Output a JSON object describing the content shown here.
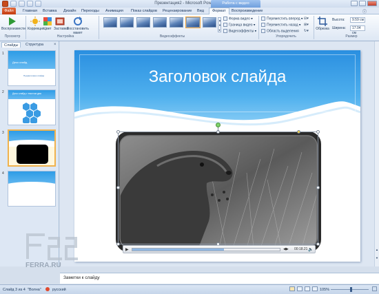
{
  "window": {
    "title": "Презентация2 - Microsoft PowerPoint",
    "context_tab_header": "Работа с видео"
  },
  "tabs": {
    "file": "Файл",
    "items": [
      "Главная",
      "Вставка",
      "Дизайн",
      "Переходы",
      "Анимация",
      "Показ слайдов",
      "Рецензирование",
      "Вид",
      "Формат",
      "Воспроизведение"
    ],
    "active": "Формат"
  },
  "ribbon": {
    "preview_group": {
      "play": "Воспроизвести",
      "label": "Просмотр"
    },
    "adjust_group": {
      "correction": "Коррекция",
      "color": "Цвет",
      "poster": "Заставка",
      "reset": "Восстановить макет",
      "label": "Настройка"
    },
    "styles_group": {
      "label": "Видеоэффекты",
      "thumb_count": 7
    },
    "shape_buttons": {
      "shape": "Форма видео",
      "border": "Граница видео",
      "effects": "Видеоэффекты"
    },
    "arrange_group": {
      "forward": "Переместить вперед",
      "backward": "Переместить назад",
      "selection": "Область выделения",
      "label": "Упорядочить"
    },
    "size_group": {
      "crop": "Обрезка",
      "height_label": "Высота:",
      "height_value": "9.59 см",
      "width_label": "Ширина:",
      "width_value": "17.04 см",
      "label": "Размер"
    }
  },
  "left_pane": {
    "tabs": [
      "Слайды",
      "Структура"
    ],
    "close": "×",
    "slides": [
      {
        "num": "1",
        "title": "Деко слайд",
        "subtitle": "Подзаголовок слайда"
      },
      {
        "num": "2",
        "title": "Деко слайд с текстом два"
      },
      {
        "num": "3"
      },
      {
        "num": "4"
      }
    ]
  },
  "slide": {
    "title": "Заголовок слайда"
  },
  "video_controls": {
    "time": "00:18.21"
  },
  "notes": {
    "text": "Заметки к слайду"
  },
  "status": {
    "slide_info": "Слайд 3 из 4",
    "theme": "\"Волна\"",
    "language": "русский",
    "zoom": "105%"
  },
  "watermark": {
    "text": "FERRA.RU"
  },
  "colors": {
    "accent": "#2a8fe0",
    "file_tab": "#c33d12",
    "context_tab": "#6f9fdd",
    "selection": "#f0b24d"
  }
}
